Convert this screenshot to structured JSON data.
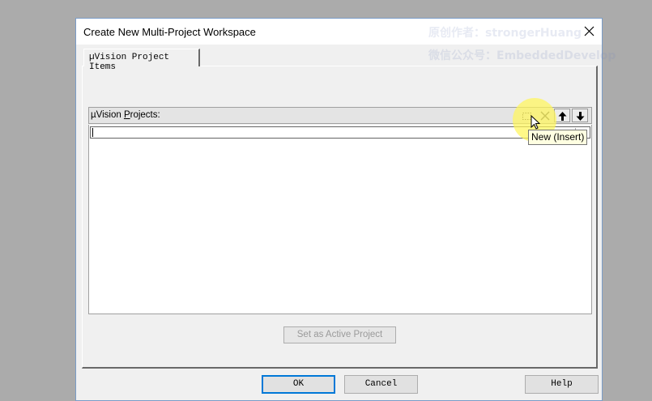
{
  "window": {
    "title": "Create New Multi-Project Workspace",
    "close_glyph": "✕"
  },
  "watermark": {
    "line1": "原创作者：strongerHuang",
    "line2": "微信公众号：EmbeddedDevelop"
  },
  "tabs": [
    {
      "label": "µVision Project Items",
      "active": true
    }
  ],
  "projects_panel": {
    "label_prefix": "µVision ",
    "label_underlined": "P",
    "label_suffix": "rojects:",
    "toolbar": [
      {
        "name": "new-icon",
        "tooltip": "New (Insert)"
      },
      {
        "name": "delete-icon"
      },
      {
        "name": "move-up-icon"
      },
      {
        "name": "move-down-icon"
      }
    ],
    "edit_value": "",
    "items": []
  },
  "set_active_button": {
    "label": "Set as Active Project",
    "enabled": false
  },
  "footer": {
    "ok_label": "OK",
    "cancel_label": "Cancel",
    "help_label": "Help"
  },
  "tooltip": {
    "text": "New (Insert)"
  },
  "colors": {
    "desktop": "#ababab",
    "dialog_bg": "#f0f0f0",
    "focus_border": "#0078d7",
    "highlight": "#fff55a",
    "tooltip_bg": "#ffffe1"
  }
}
